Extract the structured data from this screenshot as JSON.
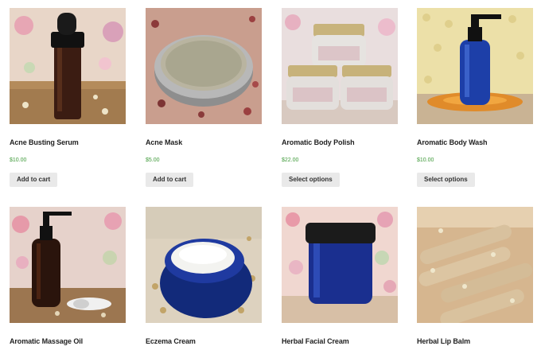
{
  "products": [
    {
      "title": "Acne Busting Serum",
      "price": "$10.00",
      "button": "Add to cart",
      "image": "amber-dropper-bottle"
    },
    {
      "title": "Acne Mask",
      "price": "$5.00",
      "button": "Add to cart",
      "image": "clay-mask-tin"
    },
    {
      "title": "Aromatic Body Polish",
      "price": "$22.00",
      "button": "Select options",
      "image": "stacked-glass-jars"
    },
    {
      "title": "Aromatic Body Wash",
      "price": "$10.00",
      "button": "Select options",
      "image": "blue-pump-bottle"
    },
    {
      "title": "Aromatic Massage Oil",
      "image": "amber-pump-bottle"
    },
    {
      "title": "Eczema Cream",
      "image": "blue-cream-jar-open"
    },
    {
      "title": "Herbal Facial Cream",
      "image": "blue-jar-black-lid"
    },
    {
      "title": "Herbal Lip Balm",
      "image": "lip-balm-tubes"
    }
  ],
  "colors": {
    "price": "#3f9a3a",
    "button_bg": "#e9e9e9"
  }
}
